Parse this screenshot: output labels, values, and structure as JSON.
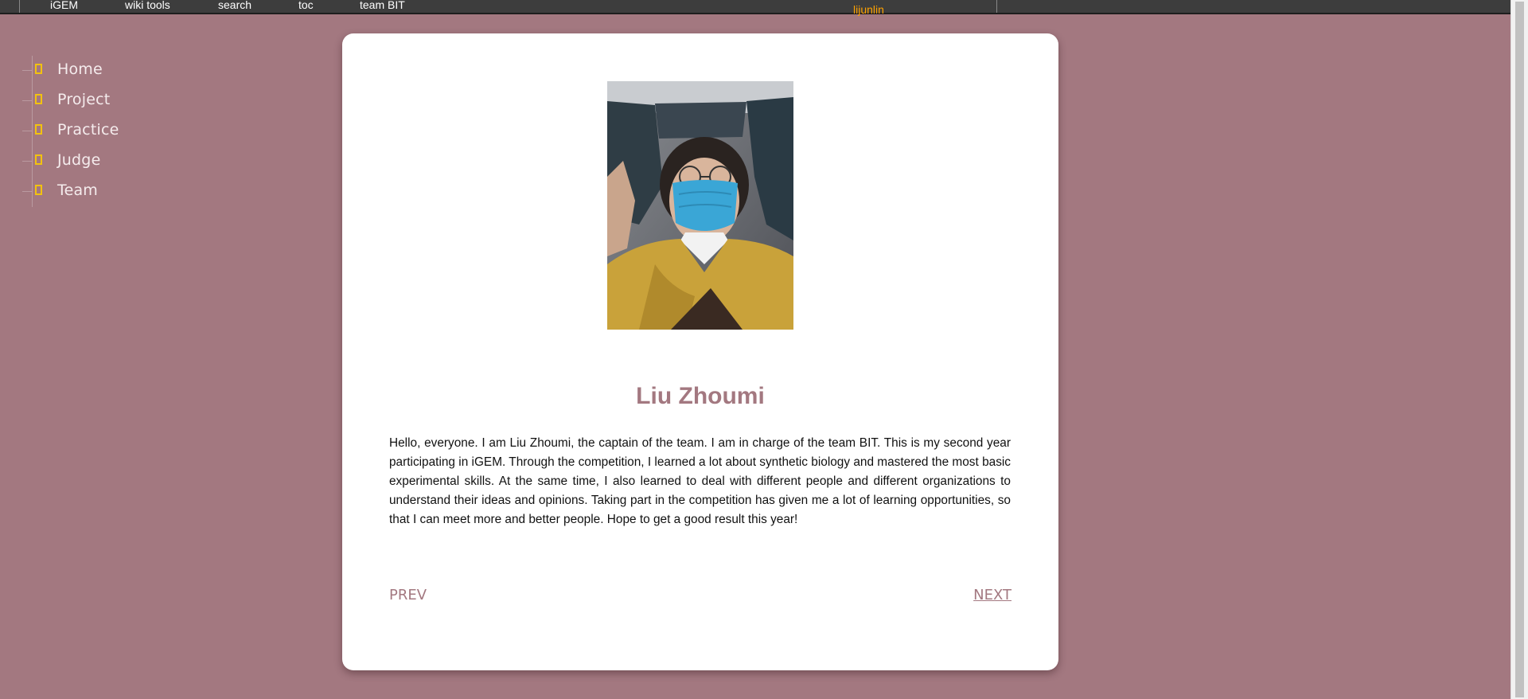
{
  "topbar": {
    "links": [
      "iGEM",
      "wiki tools",
      "search",
      "toc",
      "team BIT"
    ],
    "user": "lijunlin",
    "user_color": "#ffa200",
    "background": "#3d3d3d"
  },
  "sidebar": {
    "items": [
      {
        "label": "Home",
        "icon": "square-outline-icon"
      },
      {
        "label": "Project",
        "icon": "square-outline-icon"
      },
      {
        "label": "Practice",
        "icon": "square-outline-icon"
      },
      {
        "label": "Judge",
        "icon": "square-outline-icon"
      },
      {
        "label": "Team",
        "icon": "square-outline-icon"
      }
    ],
    "icon_color": "#f2c20f"
  },
  "profile": {
    "photo": "team-member-photo",
    "name": "Liu Zhoumi",
    "bio": "Hello, everyone. I am Liu Zhoumi, the captain of the team. I am in charge of the team BIT. This is my second year participating in iGEM. Through the competition, I learned a lot about synthetic biology and mastered the most basic experimental skills. At the same time, I also learned to deal with different people and different organizations to understand their ideas and opinions. Taking part in the competition has given me a lot of learning opportunities, so that I can meet more and better people. Hope to get a good result this year!",
    "prev_label": "PREV",
    "next_label": "NEXT"
  },
  "colors": {
    "page_background": "#a37880",
    "accent": "#a37880",
    "card": "#ffffff"
  }
}
